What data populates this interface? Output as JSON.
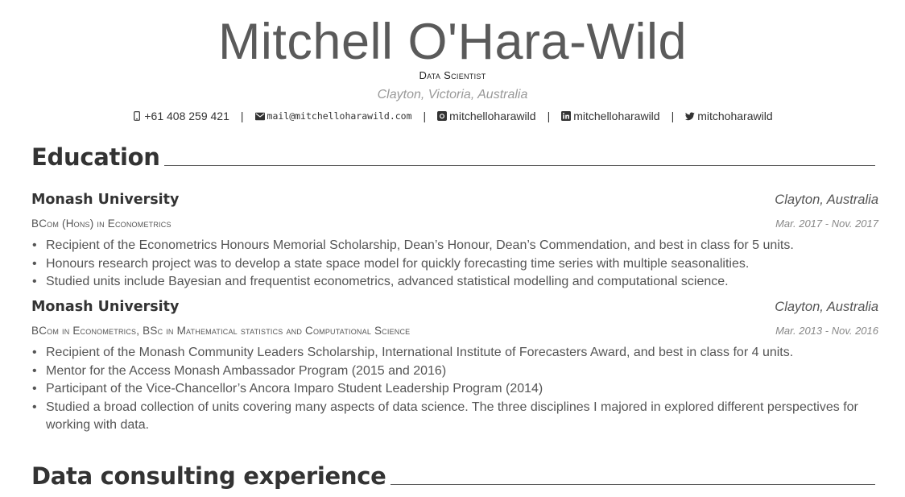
{
  "header": {
    "name": "Mitchell O'Hara-Wild",
    "position": "Data Scientist",
    "address": "Clayton, Victoria, Australia",
    "contacts": [
      {
        "icon": "mobile-phone-icon",
        "text": "+61 408 259 421"
      },
      {
        "icon": "envelope-icon",
        "text": "mail@mitchelloharawild.com"
      },
      {
        "icon": "github-icon",
        "text": "mitchelloharawild"
      },
      {
        "icon": "linkedin-icon",
        "text": "mitchelloharawild"
      },
      {
        "icon": "twitter-icon",
        "text": "mitchoharawild"
      }
    ],
    "separator": "|"
  },
  "sections": [
    {
      "title": "Education",
      "entries": [
        {
          "institution": "Monash University",
          "location": "Clayton, Australia",
          "degree": "BCom (Hons) in Econometrics",
          "dates": "Mar. 2017 - Nov. 2017",
          "bullets": [
            "Recipient of the Econometrics Honours Memorial Scholarship, Dean’s Honour, Dean’s Commendation, and best in class for 5 units.",
            "Honours research project was to develop a state space model for quickly forecasting time series with multiple seasonalities.",
            "Studied units include Bayesian and frequentist econometrics, advanced statistical modelling and computational science."
          ]
        },
        {
          "institution": "Monash University",
          "location": "Clayton, Australia",
          "degree": "BCom in Econometrics, BSc in Mathematical statistics and Computational Science",
          "dates": "Mar. 2013 - Nov. 2016",
          "bullets": [
            "Recipient of the Monash Community Leaders Scholarship, International Institute of Forecasters Award, and best in class for 4 units.",
            "Mentor for the Access Monash Ambassador Program (2015 and 2016)",
            "Participant of the Vice-Chancellor’s Ancora Imparo Student Leadership Program (2014)",
            "Studied a broad collection of units covering many aspects of data science.  The three disciplines I majored in explored different perspectives for working with data."
          ]
        }
      ]
    },
    {
      "title": "Data consulting experience",
      "entries": []
    }
  ]
}
